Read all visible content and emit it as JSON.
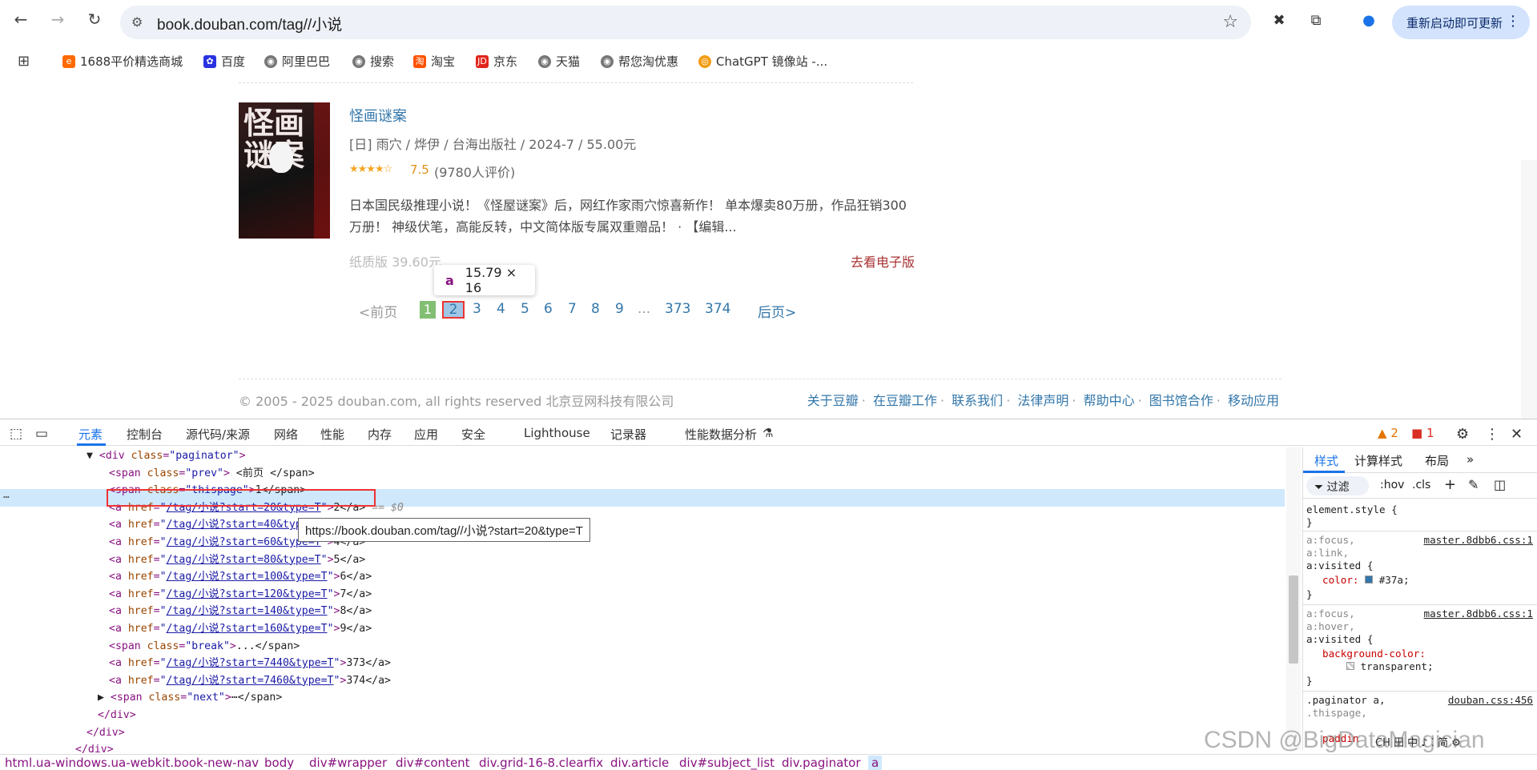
{
  "browser": {
    "url": "book.douban.com/tag//小说",
    "update_button": "重新启动即可更新",
    "bookmarks": [
      "1688平价精选商城",
      "百度",
      "阿里巴巴",
      "搜索",
      "淘宝",
      "京东",
      "天猫",
      "帮您淘优惠",
      "ChatGPT 镜像站 -..."
    ]
  },
  "book": {
    "title": "怪画谜案",
    "cover_text": "怪画谜案",
    "publication": "[日] 雨穴 / 烨伊 / 台海出版社 / 2024-7 / 55.00元",
    "stars": "★★★★☆",
    "rating": "7.5",
    "rating_count": "(9780人评价)",
    "description": "日本国民级推理小说！《怪屋谜案》后，网红作家雨穴惊喜新作！ 单本爆卖80万册，作品狂销300万册！ 神级伏笔，高能反转，中文简体版专属双重赠品！ · 【编辑...",
    "paper_price": "纸质版 39.60元",
    "ebook_link": "去看电子版"
  },
  "element_tooltip": {
    "tag": "a",
    "size": "15.79 × 16"
  },
  "paginator": {
    "prev": "<前页",
    "current": "1",
    "pages": [
      "2",
      "3",
      "4",
      "5",
      "6",
      "7",
      "8",
      "9"
    ],
    "break": "...",
    "last_pages": [
      "373",
      "374"
    ],
    "next": "后页>"
  },
  "footer": {
    "copyright": "© 2005 - 2025 douban.com, all rights reserved 北京豆网科技有限公司",
    "links": [
      "关于豆瓣",
      "在豆瓣工作",
      "联系我们",
      "法律声明",
      "帮助中心",
      "图书馆合作",
      "移动应用"
    ]
  },
  "devtools": {
    "tabs": [
      "元素",
      "控制台",
      "源代码/来源",
      "网络",
      "性能",
      "内存",
      "应用",
      "安全",
      "Lighthouse",
      "记录器",
      "性能数据分析"
    ],
    "warnings": "2",
    "errors": "1",
    "dom_lines": [
      {
        "indent": 0,
        "pre": "▼",
        "open": "<div",
        "attr": "class",
        "val": "\"paginator\"",
        "close": ">",
        "text": ""
      },
      {
        "indent": 1,
        "open": "<span",
        "attr": "class",
        "val": "\"prev\"",
        "close": ">",
        "text": " <前页 </span>"
      },
      {
        "indent": 1,
        "open": "<span",
        "attr": "class",
        "val": "\"thispage\"",
        "close": ">",
        "text": "1</span>"
      },
      {
        "indent": 1,
        "open": "<a",
        "attr": "href",
        "link": "/tag/小说?start=20&type=T",
        "close": ">",
        "text": "2</a>",
        "suffix": " == $0"
      },
      {
        "indent": 1,
        "open": "<a",
        "attr": "href",
        "link": "/tag/小说?start=40&type=T",
        "close": ">",
        "text": "3</a>"
      },
      {
        "indent": 1,
        "open": "<a",
        "attr": "href",
        "link": "/tag/小说?start=60&type=T",
        "close": ">",
        "text": "4</a>"
      },
      {
        "indent": 1,
        "open": "<a",
        "attr": "href",
        "link": "/tag/小说?start=80&type=T",
        "close": ">",
        "text": "5</a>"
      },
      {
        "indent": 1,
        "open": "<a",
        "attr": "href",
        "link": "/tag/小说?start=100&type=T",
        "close": ">",
        "text": "6</a>"
      },
      {
        "indent": 1,
        "open": "<a",
        "attr": "href",
        "link": "/tag/小说?start=120&type=T",
        "close": ">",
        "text": "7</a>"
      },
      {
        "indent": 1,
        "open": "<a",
        "attr": "href",
        "link": "/tag/小说?start=140&type=T",
        "close": ">",
        "text": "8</a>"
      },
      {
        "indent": 1,
        "open": "<a",
        "attr": "href",
        "link": "/tag/小说?start=160&type=T",
        "close": ">",
        "text": "9</a>"
      },
      {
        "indent": 1,
        "open": "<span",
        "attr": "class",
        "val": "\"break\"",
        "close": ">",
        "text": "...</span>"
      },
      {
        "indent": 1,
        "open": "<a",
        "attr": "href",
        "link": "/tag/小说?start=7440&type=T",
        "close": ">",
        "text": "373</a>"
      },
      {
        "indent": 1,
        "open": "<a",
        "attr": "href",
        "link": "/tag/小说?start=7460&type=T",
        "close": ">",
        "text": "374</a>"
      },
      {
        "indent": 1,
        "pre": "▶",
        "open": "<span",
        "attr": "class",
        "val": "\"next\"",
        "close": ">",
        "text": "⋯</span>"
      },
      {
        "indent": 0,
        "open": "</div>",
        "text": ""
      },
      {
        "indent": -1,
        "open": "</div>",
        "text": ""
      },
      {
        "indent": -2,
        "open": "</div>",
        "text": ""
      }
    ],
    "link_tooltip": "https://book.douban.com/tag//小说?start=20&type=T",
    "styles_tabs": [
      "样式",
      "计算样式",
      "布局"
    ],
    "filter": "过滤",
    "hov": ":hov",
    "cls": ".cls",
    "rules": {
      "element_style": "element.style {",
      "r1_selectors": [
        "a:focus,",
        "a:link,",
        "a:visited {"
      ],
      "r1_source": "master.8dbb6.css:1",
      "r1_prop": "color:",
      "r1_value": "#37a;",
      "r2_selectors": [
        "a:focus,",
        "a:hover,",
        "a:visited {"
      ],
      "r2_source": "master.8dbb6.css:1",
      "r2_prop": "background-color:",
      "r2_value": "transparent;",
      "r3_selector": ".paginator a,",
      "r3_selector2": ".thispage,",
      "r3_source": "douban.css:456",
      "r3_prop": "paddin",
      "brace_close": "}"
    },
    "breadcrumbs": [
      "html.ua-windows.ua-webkit.book-new-nav",
      "body",
      "div#wrapper",
      "div#content",
      "div.grid-16-8.clearfix",
      "div.article",
      "div#subject_list",
      "div.paginator",
      "a"
    ],
    "ime_status": "CH 田 中 ♪ ⁚ 简 ⚙"
  },
  "watermark": "CSDN @BigDataMagician",
  "colors": {
    "link": "#3377aa",
    "devtools_accent": "#1a73e8",
    "highlight": "#e33333"
  }
}
